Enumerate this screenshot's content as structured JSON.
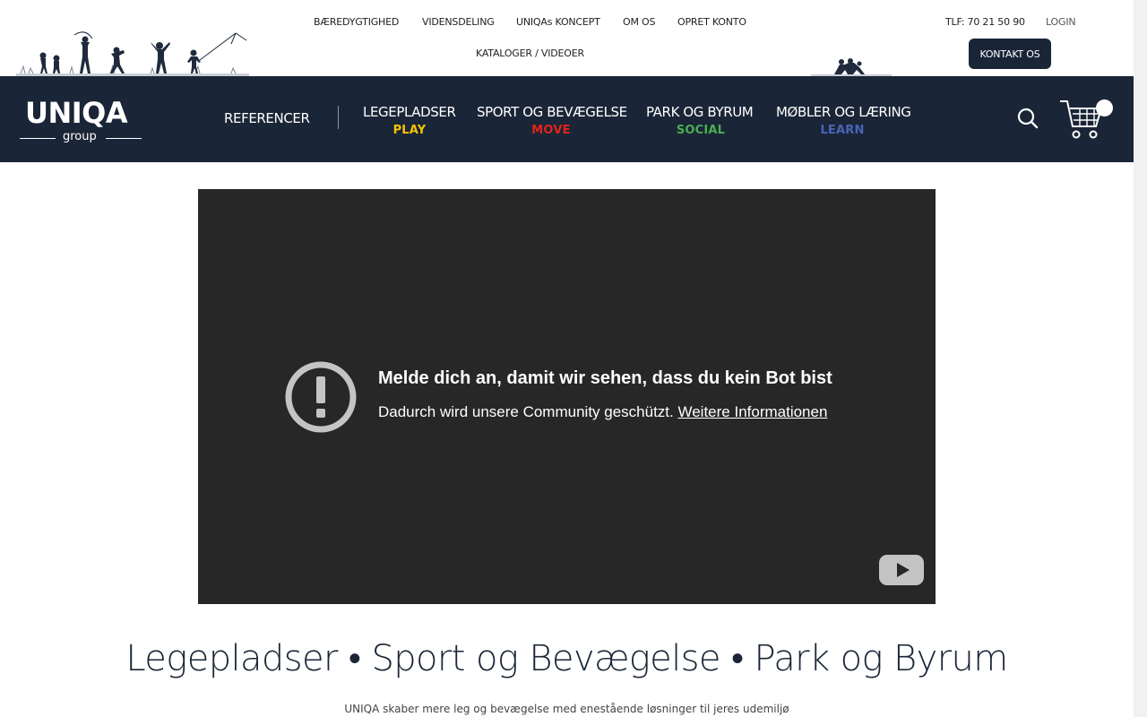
{
  "topbar": {
    "links": [
      "BÆREDYGTIGHED",
      "VIDENSDELING",
      "UNIQAs KONCEPT",
      "OM OS",
      "OPRET KONTO"
    ],
    "second_row_link": "KATALOGER / VIDEOER",
    "phone": "TLF: 70 21 50 90",
    "login": "LOGIN",
    "contact_button": "KONTAKT OS"
  },
  "logo": {
    "word": "UNIQA",
    "sub": "group"
  },
  "nav": {
    "references": "REFERENCER",
    "items": [
      {
        "label": "LEGEPLADSER",
        "sub": "PLAY",
        "color": "#f5c400"
      },
      {
        "label": "SPORT OG BEVÆGELSE",
        "sub": "MOVE",
        "color": "#e2231a"
      },
      {
        "label": "PARK OG BYRUM",
        "sub": "SOCIAL",
        "color": "#4caf50"
      },
      {
        "label": "MØBLER OG LÆRING",
        "sub": "LEARN",
        "color": "#4a64b8"
      }
    ]
  },
  "video": {
    "title": "Melde dich an, damit wir sehen, dass du kein Bot bist",
    "body": "Dadurch wird unsere Community geschützt.",
    "link": "Weitere Informationen"
  },
  "content": {
    "headline": "Legepladser • Sport og Bevægelse • Park og Byrum",
    "subline": "UNIQA skaber mere leg og bevægelse med enestående løsninger til jeres udemiljø"
  },
  "colors": {
    "navy": "#1a2537",
    "video_bg": "#272727"
  }
}
